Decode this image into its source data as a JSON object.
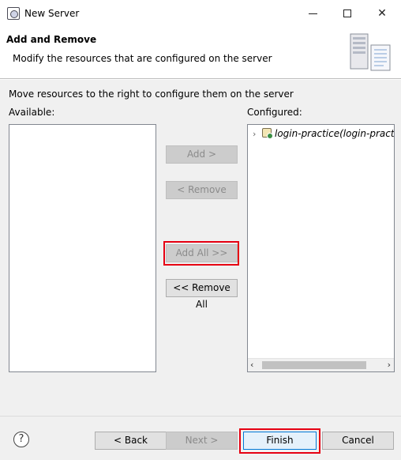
{
  "window": {
    "title": "New Server",
    "icon": "server-app-icon"
  },
  "header": {
    "title": "Add and Remove",
    "description": "Modify the resources that are configured on the server",
    "graphic": "server-wizard-graphic"
  },
  "content": {
    "hint": "Move resources to the right to configure them on the server",
    "available_label": "Available:",
    "configured_label": "Configured:",
    "available_items": [],
    "configured_items": [
      {
        "label": "login-practice(login-practice)",
        "icon": "web-project-icon",
        "expanded": false
      }
    ]
  },
  "buttons": {
    "add": "Add >",
    "remove": "< Remove",
    "add_all": "Add All >>",
    "remove_all": "<< Remove All"
  },
  "footer": {
    "help": "?",
    "back": "< Back",
    "next": "Next >",
    "finish": "Finish",
    "cancel": "Cancel"
  },
  "colors": {
    "highlight": "#e60012",
    "default_button_border": "#0078d7"
  }
}
